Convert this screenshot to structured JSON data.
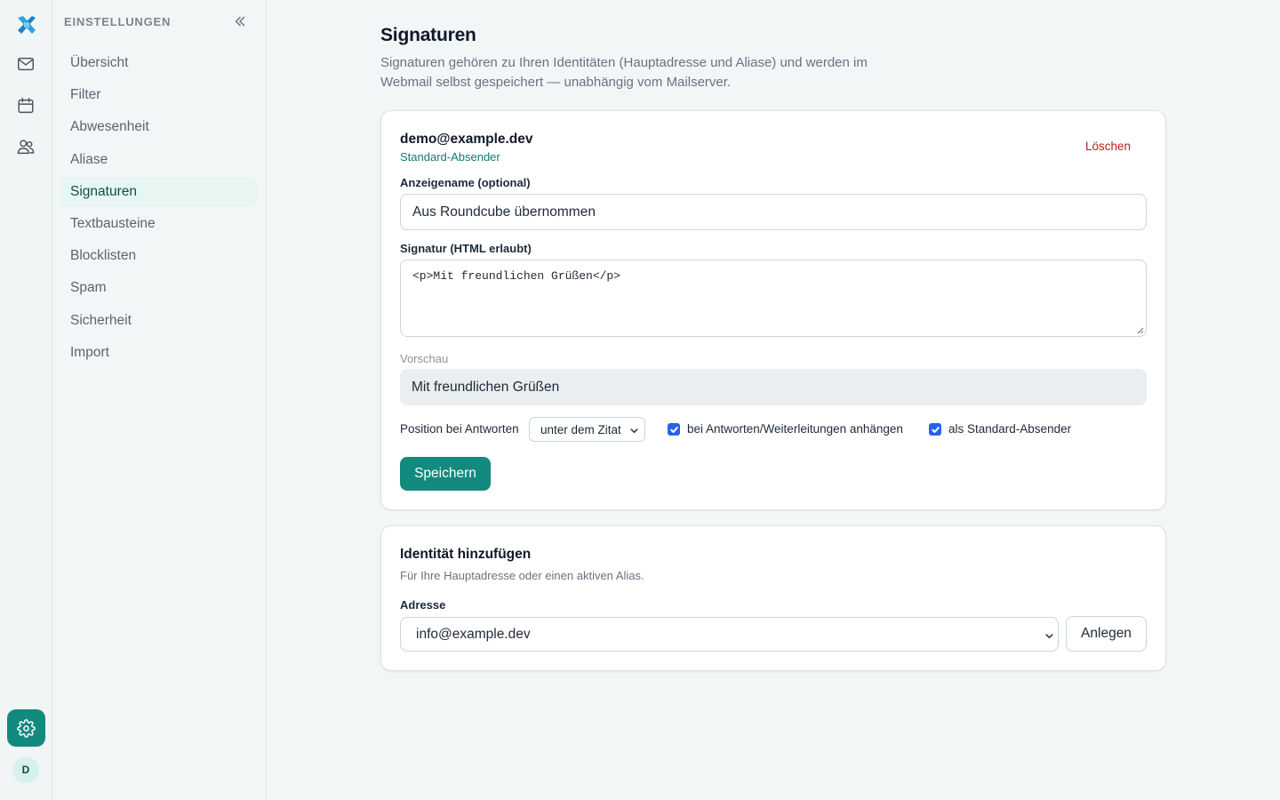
{
  "colors": {
    "accent": "#138a7e",
    "danger": "#b42318",
    "checkbox": "#2563eb",
    "active_bg": "#e8f6f3"
  },
  "rail": {
    "icons": [
      "app-logo-icon",
      "mail-icon",
      "calendar-icon",
      "contacts-icon",
      "settings-gear-icon"
    ],
    "avatar_initial": "D"
  },
  "sidebar": {
    "heading": "EINSTELLUNGEN",
    "items": [
      {
        "label": "Übersicht"
      },
      {
        "label": "Filter"
      },
      {
        "label": "Abwesenheit"
      },
      {
        "label": "Aliase"
      },
      {
        "label": "Signaturen"
      },
      {
        "label": "Textbausteine"
      },
      {
        "label": "Blocklisten"
      },
      {
        "label": "Spam"
      },
      {
        "label": "Sicherheit"
      },
      {
        "label": "Import"
      }
    ],
    "active_item": "Signaturen"
  },
  "page": {
    "title": "Signaturen",
    "description": "Signaturen gehören zu Ihren Identitäten (Hauptadresse und Aliase) und werden im Webmail selbst gespeichert — unabhängig vom Mailserver."
  },
  "identity": {
    "email": "demo@example.dev",
    "badge": "Standard-Absender",
    "delete_label": "Löschen",
    "display_name_label": "Anzeigename (optional)",
    "display_name_value": "Aus Roundcube übernommen",
    "signature_label": "Signatur (HTML erlaubt)",
    "signature_value": "<p>Mit freundlichen Grüßen</p>",
    "preview_label": "Vorschau",
    "preview_value": "Mit freundlichen Grüßen",
    "position_label": "Position bei Antworten",
    "position_value": "unter dem Zitat",
    "append_label": "bei Antworten/Weiterleitungen anhängen",
    "append_checked": true,
    "default_sender_label": "als Standard-Absender",
    "default_sender_checked": true,
    "save_label": "Speichern"
  },
  "add_identity": {
    "title": "Identität hinzufügen",
    "description": "Für Ihre Hauptadresse oder einen aktiven Alias.",
    "address_label": "Adresse",
    "address_value": "info@example.dev",
    "create_label": "Anlegen"
  }
}
